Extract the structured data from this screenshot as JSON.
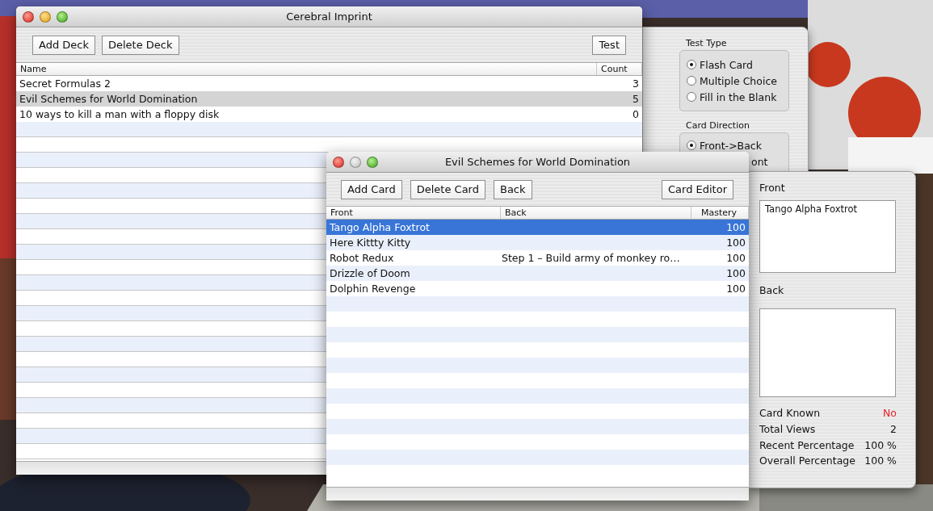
{
  "deck_window": {
    "title": "Cerebral Imprint",
    "minimize_enabled": true,
    "buttons": [
      "Add Deck",
      "Delete Deck"
    ],
    "test_button": "Test",
    "columns": [
      "Name",
      "Count"
    ],
    "rows": [
      {
        "name": "Secret Formulas 2",
        "count": "3",
        "selected": false
      },
      {
        "name": "Evil Schemes for World Domination",
        "count": "5",
        "selected": true
      },
      {
        "name": "10 ways to kill a man with a floppy disk",
        "count": "0",
        "selected": false
      }
    ]
  },
  "test_drawer": {
    "test_type_label": "Test Type",
    "test_types": [
      {
        "label": "Flash Card",
        "selected": true
      },
      {
        "label": "Multiple Choice",
        "selected": false
      },
      {
        "label": "Fill in the Blank",
        "selected": false
      }
    ],
    "direction_label": "Card Direction",
    "directions": [
      {
        "label": "Front->Back",
        "selected": true
      }
    ],
    "partial_text": "ont"
  },
  "card_window": {
    "title": "Evil Schemes for World Domination",
    "minimize_enabled": false,
    "buttons": [
      "Add Card",
      "Delete Card",
      "Back"
    ],
    "editor_button": "Card Editor",
    "columns": [
      "Front",
      "Back",
      "Mastery"
    ],
    "rows": [
      {
        "front": "Tango Alpha Foxtrot",
        "back": "",
        "mastery": "100",
        "selected": true
      },
      {
        "front": "Here Kittty Kitty",
        "back": "",
        "mastery": "100",
        "selected": false
      },
      {
        "front": "Robot Redux",
        "back": "Step 1 – Build army of monkey ro…",
        "mastery": "100",
        "selected": false
      },
      {
        "front": "Drizzle of Doom",
        "back": "",
        "mastery": "100",
        "selected": false
      },
      {
        "front": "Dolphin Revenge",
        "back": "",
        "mastery": "100",
        "selected": false
      }
    ]
  },
  "editor_drawer": {
    "front_label": "Front",
    "front_text": "Tango Alpha Foxtrot",
    "back_label": "Back",
    "stats": [
      {
        "label": "Card Known",
        "value": "No",
        "kind": "alert"
      },
      {
        "label": "Total Views",
        "value": "2",
        "kind": "plain"
      },
      {
        "label": "Recent Percentage",
        "value": "100 %",
        "kind": "plain"
      },
      {
        "label": "Overall Percentage",
        "value": "100 %",
        "kind": "plain"
      }
    ]
  }
}
